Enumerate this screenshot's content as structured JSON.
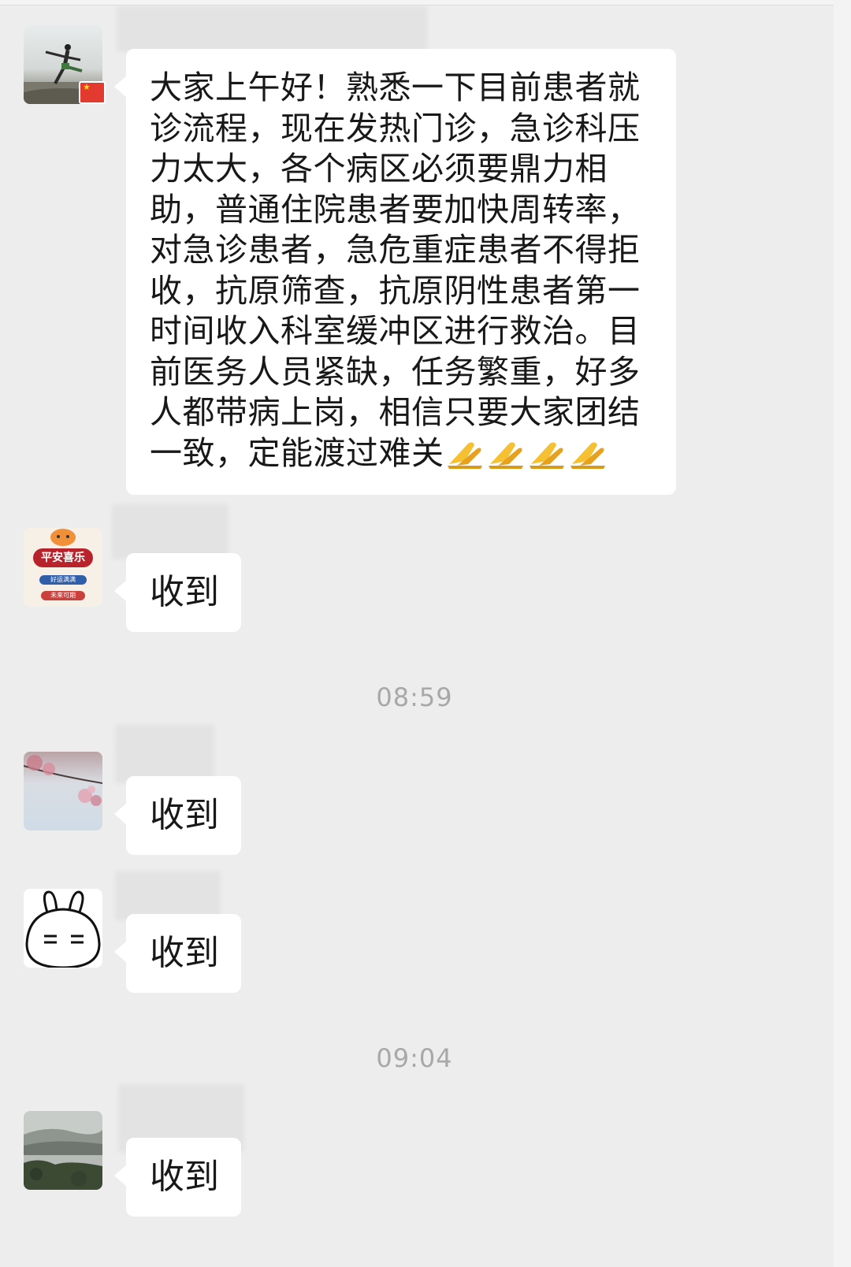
{
  "messages": [
    {
      "avatar": "sunset-pose-avatar",
      "badge": "china-flag-badge",
      "text": "大家上午好！熟悉一下目前患者就诊流程，现在发热门诊，急诊科压力太大，各个病区必须要鼎力相助，普通住院患者要加快周转率，对急诊患者，急危重症患者不得拒收，抗原筛查，抗原阴性患者第一时间收入科室缓冲区进行救治。目前医务人员紧缺，任务繁重，好多人都带病上岗，相信只要大家团结一致，定能渡过难关",
      "emoji": [
        "folded-hands",
        "folded-hands",
        "folded-hands",
        "folded-hands"
      ]
    },
    {
      "avatar": "tiger-sticker-avatar",
      "avatar_text": [
        "平安喜乐",
        "好运满满",
        "未来可期"
      ],
      "text": "收到"
    },
    {
      "timestamp": "08:59"
    },
    {
      "avatar": "cherry-blossom-avatar",
      "text": "收到"
    },
    {
      "avatar": "white-rabbit-avatar",
      "text": "收到"
    },
    {
      "timestamp": "09:04"
    },
    {
      "avatar": "mountain-lake-avatar",
      "text": "收到"
    }
  ],
  "colors": {
    "background": "#ededed",
    "bubble": "#ffffff",
    "timestamp": "#a8a8a8"
  }
}
